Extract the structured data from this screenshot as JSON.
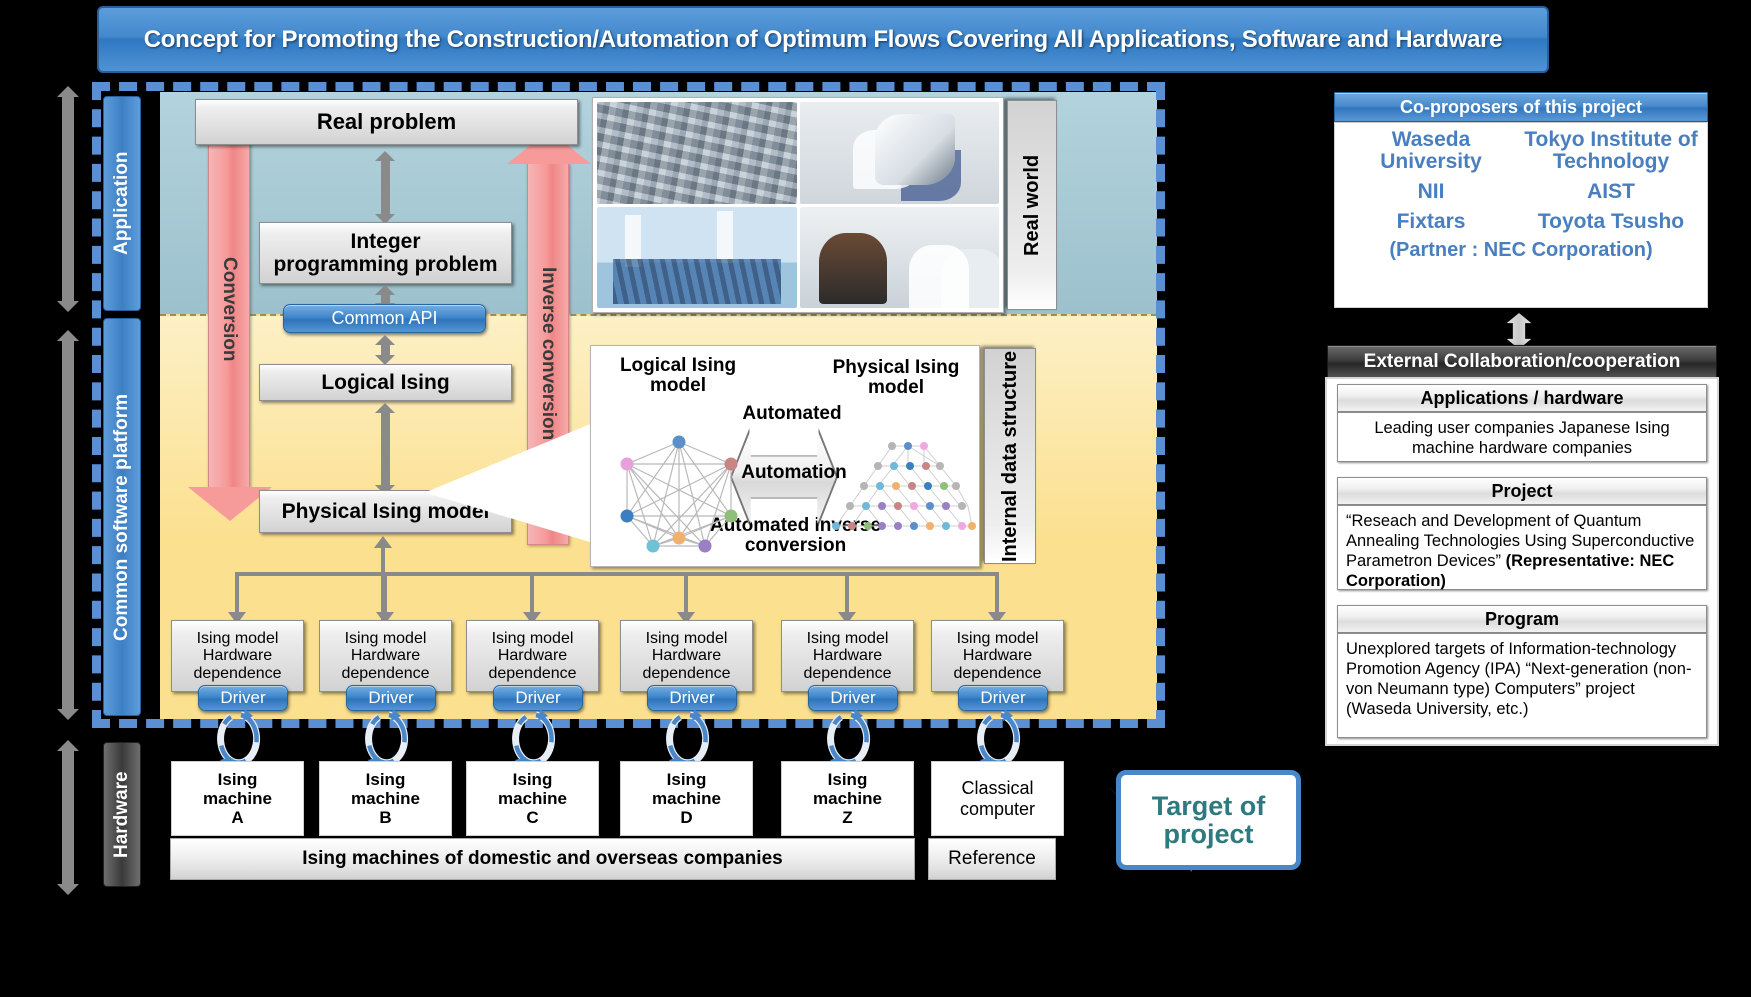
{
  "title": "Concept for Promoting the Construction/Automation of Optimum Flows Covering All Applications, Software and Hardware",
  "bands": {
    "application": "Application",
    "platform": "Common software platform",
    "hardware": "Hardware"
  },
  "flow": {
    "real_problem": "Real problem",
    "integer_problem": "Integer\nprogramming problem",
    "common_api": "Common API",
    "logical_ising": "Logical Ising",
    "physical_ising": "Physical Ising model",
    "conversion": "Conversion",
    "inverse_conversion": "Inverse conversion"
  },
  "side_labels": {
    "real_world": "Real world",
    "internal_data_structure": "Internal data structure"
  },
  "automation_panel": {
    "logical_label": "Logical Ising model",
    "physical_label": "Physical Ising model",
    "automated": "Automated",
    "automation": "Automation",
    "automated_inverse": "Automated inverse conversion"
  },
  "ising_modules": [
    {
      "title": "Ising model\nHardware\ndependence",
      "driver": "Driver"
    },
    {
      "title": "Ising model\nHardware\ndependence",
      "driver": "Driver"
    },
    {
      "title": "Ising model\nHardware\ndependence",
      "driver": "Driver"
    },
    {
      "title": "Ising model\nHardware\ndependence",
      "driver": "Driver"
    },
    {
      "title": "Ising model\nHardware\ndependence",
      "driver": "Driver"
    },
    {
      "title": "Ising model\nHardware\ndependence",
      "driver": "Driver"
    }
  ],
  "machines": [
    "Ising\nmachine\nA",
    "Ising\nmachine\nB",
    "Ising\nmachine\nC",
    "Ising\nmachine\nD",
    "Ising\nmachine\nZ",
    "Classical\ncomputer"
  ],
  "footer": {
    "machines_bar": "Ising machines of domestic and overseas companies",
    "reference": "Reference"
  },
  "target_callout": "Target of project",
  "coproposers": {
    "header": "Co-proposers of this project",
    "items": [
      "Waseda University",
      "Tokyo Institute of Technology",
      "NII",
      "AIST",
      "Fixtars",
      "Toyota Tsusho"
    ],
    "partner": "(Partner : NEC Corporation)"
  },
  "external": {
    "header": "External Collaboration/cooperation",
    "sections": [
      {
        "title": "Applications / hardware",
        "body": "Leading user companies Japanese Ising machine hardware companies"
      },
      {
        "title": "Project",
        "body": "“Reseach and Development of Quantum Annealing Technologies Using Superconductive Parametron Devices”",
        "bold_line": "(Representative: NEC Corporation)"
      },
      {
        "title": "Program",
        "body": "Unexplored targets of Information-technology Promotion Agency (IPA) “Next-generation (non-von Neumann type) Computers” project (Waseda University, etc.)"
      }
    ]
  },
  "colors": {
    "accent_blue": "#4a87c8",
    "title_blue": "#3f88cd",
    "application_bg": "#a9cbd7",
    "platform_bg": "#fbe08f",
    "pink_arrow": "#f79a9a",
    "teal_text": "#2e7a7f",
    "coproposer_text": "#4a7fbf"
  }
}
